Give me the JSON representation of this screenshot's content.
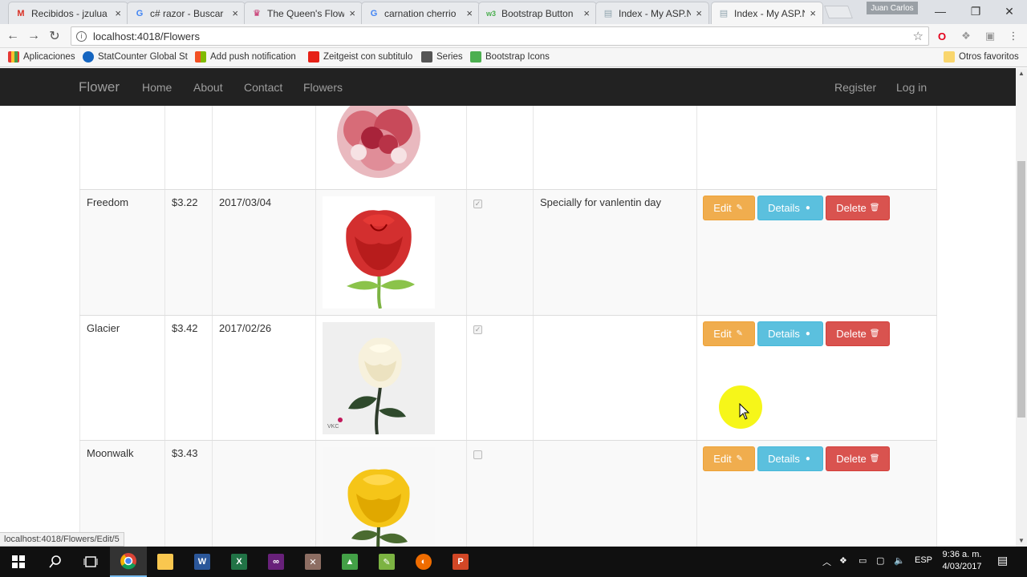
{
  "browser": {
    "tabs": [
      {
        "title": "Recibidos - jzulua",
        "icon": "gmail-icon",
        "color": "#d93025",
        "glyph": "M"
      },
      {
        "title": "c# razor - Buscar",
        "icon": "google-icon",
        "color": "#4285f4",
        "glyph": "G"
      },
      {
        "title": "The Queen's Flow",
        "icon": "flower-shop-icon",
        "color": "#c2185b",
        "glyph": "♛"
      },
      {
        "title": "carnation cherrio",
        "icon": "google-icon",
        "color": "#4285f4",
        "glyph": "G"
      },
      {
        "title": "Bootstrap Button",
        "icon": "w3schools-icon",
        "color": "#4caf50",
        "glyph": "w3"
      },
      {
        "title": "Index - My ASP.N",
        "icon": "page-icon",
        "color": "#90a4ae",
        "glyph": "▤"
      },
      {
        "title": "Index - My ASP.N",
        "icon": "page-icon",
        "color": "#90a4ae",
        "glyph": "▤"
      }
    ],
    "active_tab": 6,
    "user_name": "Juan Carlos",
    "url": "localhost:4018/Flowers",
    "bookmarks": [
      {
        "label": "Aplicaciones",
        "icon": "apps-grid-icon",
        "color": "#e53935"
      },
      {
        "label": "StatCounter Global St",
        "icon": "statcounter-icon",
        "color": "#1565c0"
      },
      {
        "label": "Add push notification",
        "icon": "microsoft-icon",
        "color": "#7cb342"
      },
      {
        "label": "Zeitgeist con subtitulo",
        "icon": "youtube-icon",
        "color": "#e62117"
      },
      {
        "label": "Series",
        "icon": "film-icon",
        "color": "#555555"
      },
      {
        "label": "Bootstrap Icons",
        "icon": "w3schools-icon",
        "color": "#4caf50"
      }
    ],
    "other_bookmarks": "Otros favoritos",
    "status_url": "localhost:4018/Flowers/Edit/5"
  },
  "navbar": {
    "brand": "Flower",
    "links": [
      "Home",
      "About",
      "Contact",
      "Flowers"
    ],
    "register": "Register",
    "login": "Log in"
  },
  "actions": {
    "edit": "Edit",
    "details": "Details",
    "delete": "Delete"
  },
  "flowers": [
    {
      "name": "Freedom",
      "price": "$3.22",
      "date": "2017/03/04",
      "image": "red-rose",
      "checked": true,
      "description": "Specially for vanlentin day"
    },
    {
      "name": "Glacier",
      "price": "$3.42",
      "date": "2017/02/26",
      "image": "white-rose",
      "checked": true,
      "description": ""
    },
    {
      "name": "Moonwalk",
      "price": "$3.43",
      "date": "",
      "image": "yellow-rose",
      "checked": false,
      "description": ""
    }
  ],
  "taskbar": {
    "apps": [
      {
        "icon": "windows-start-icon"
      },
      {
        "icon": "search-icon"
      },
      {
        "icon": "task-view-icon"
      },
      {
        "icon": "chrome-icon",
        "active": true
      },
      {
        "icon": "file-explorer-icon"
      },
      {
        "icon": "word-icon"
      },
      {
        "icon": "excel-icon"
      },
      {
        "icon": "visual-studio-icon"
      },
      {
        "icon": "tool-icon"
      },
      {
        "icon": "app-icon"
      },
      {
        "icon": "notepad-icon"
      },
      {
        "icon": "app-icon"
      },
      {
        "icon": "powerpoint-icon"
      }
    ],
    "language": "ESP",
    "time": "9:36 a. m.",
    "date": "4/03/2017"
  }
}
